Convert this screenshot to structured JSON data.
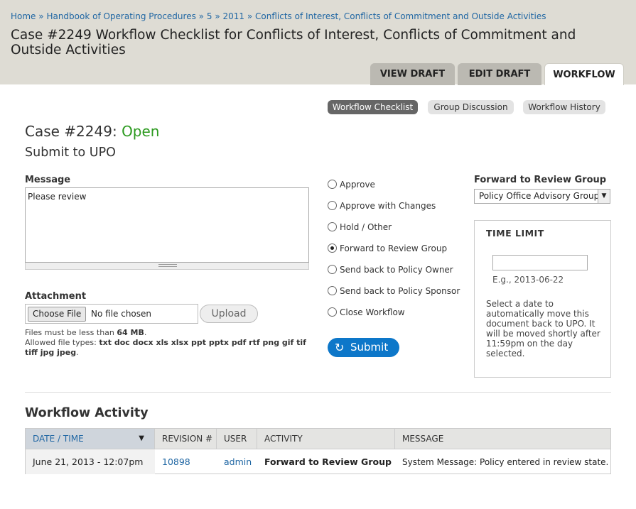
{
  "breadcrumb": {
    "items": [
      "Home",
      "Handbook of Operating Procedures",
      "5",
      "2011",
      "Conflicts of Interest, Conflicts of Commitment and Outside Activities"
    ],
    "separator": "»"
  },
  "page_title": "Case #2249 Workflow Checklist for Conflicts of Interest, Conflicts of Commitment and Outside Activities",
  "tabs": [
    {
      "label": "VIEW DRAFT",
      "active": false
    },
    {
      "label": "EDIT DRAFT",
      "active": false
    },
    {
      "label": "WORKFLOW",
      "active": true
    }
  ],
  "subnav": [
    {
      "label": "Workflow Checklist",
      "active": true
    },
    {
      "label": "Group Discussion",
      "active": false
    },
    {
      "label": "Workflow History",
      "active": false
    }
  ],
  "case": {
    "prefix": "Case #2249:",
    "status": "Open",
    "status_color": "#2c9a1f",
    "step": "Submit to UPO"
  },
  "message": {
    "label": "Message",
    "value": "Please review"
  },
  "attachment": {
    "label": "Attachment",
    "choose_label": "Choose File",
    "no_file_text": "No file chosen",
    "upload_label": "Upload",
    "size_prefix": "Files must be less than",
    "size_limit": "64 MB",
    "types_prefix": "Allowed file types:",
    "types": "txt doc docx xls xlsx ppt pptx pdf rtf png gif tif tiff jpg jpeg"
  },
  "actions": {
    "options": [
      {
        "label": "Approve",
        "checked": false
      },
      {
        "label": "Approve with Changes",
        "checked": false
      },
      {
        "label": "Hold / Other",
        "checked": false
      },
      {
        "label": "Forward to Review Group",
        "checked": true
      },
      {
        "label": "Send back to Policy Owner",
        "checked": false
      },
      {
        "label": "Send back to Policy Sponsor",
        "checked": false
      },
      {
        "label": "Close Workflow",
        "checked": false
      }
    ],
    "submit_label": "Submit",
    "submit_icon": "refresh-icon",
    "accent_color": "#0d77c9"
  },
  "forward": {
    "label": "Forward to Review Group",
    "selected": "Policy Office Advisory Group"
  },
  "time_limit": {
    "title": "TIME LIMIT",
    "value": "",
    "example": "E.g., 2013-06-22",
    "description": "Select a date to automatically move this document back to UPO. It will be moved shortly after 11:59pm on the day selected."
  },
  "activity": {
    "heading": "Workflow Activity",
    "columns": [
      "DATE / TIME",
      "REVISION #",
      "USER",
      "ACTIVITY",
      "MESSAGE"
    ],
    "rows": [
      {
        "date_time": "June 21, 2013 - 12:07pm",
        "revision": "10898",
        "user": "admin",
        "activity": "Forward to Review Group",
        "message": "System Message: Policy entered in review state."
      }
    ]
  }
}
